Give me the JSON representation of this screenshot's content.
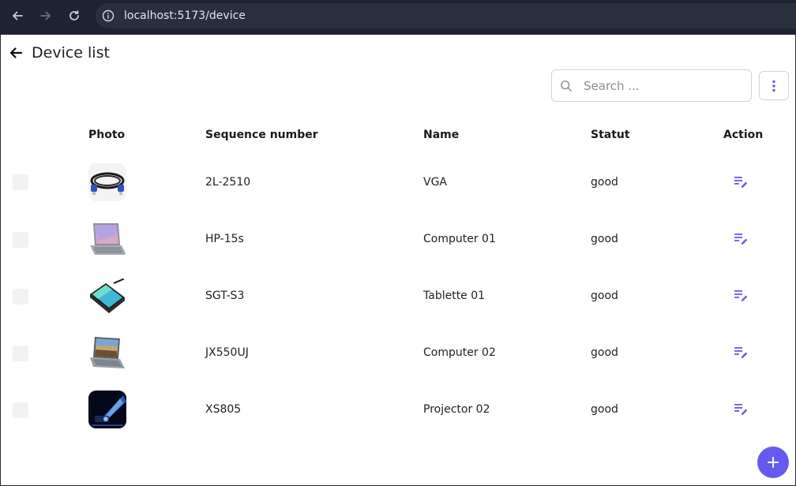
{
  "browser": {
    "url": "localhost:5173/device"
  },
  "header": {
    "title": "Device list"
  },
  "search": {
    "placeholder": "Search ..."
  },
  "table": {
    "columns": [
      "Photo",
      "Sequence number",
      "Name",
      "Statut",
      "Action"
    ],
    "rows": [
      {
        "photo_icon": "vga-cable-photo",
        "sequence": "2L-2510",
        "name": "VGA",
        "status": "good"
      },
      {
        "photo_icon": "laptop-photo",
        "sequence": "HP-15s",
        "name": "Computer 01",
        "status": "good"
      },
      {
        "photo_icon": "tablet-photo",
        "sequence": "SGT-S3",
        "name": "Tablette 01",
        "status": "good"
      },
      {
        "photo_icon": "laptop-photo",
        "sequence": "JX550UJ",
        "name": "Computer 02",
        "status": "good"
      },
      {
        "photo_icon": "projector-photo",
        "sequence": "XS805",
        "name": "Projector 02",
        "status": "good"
      }
    ]
  },
  "colors": {
    "accent": "#6659f0",
    "browser_bar": "#1f2330"
  }
}
